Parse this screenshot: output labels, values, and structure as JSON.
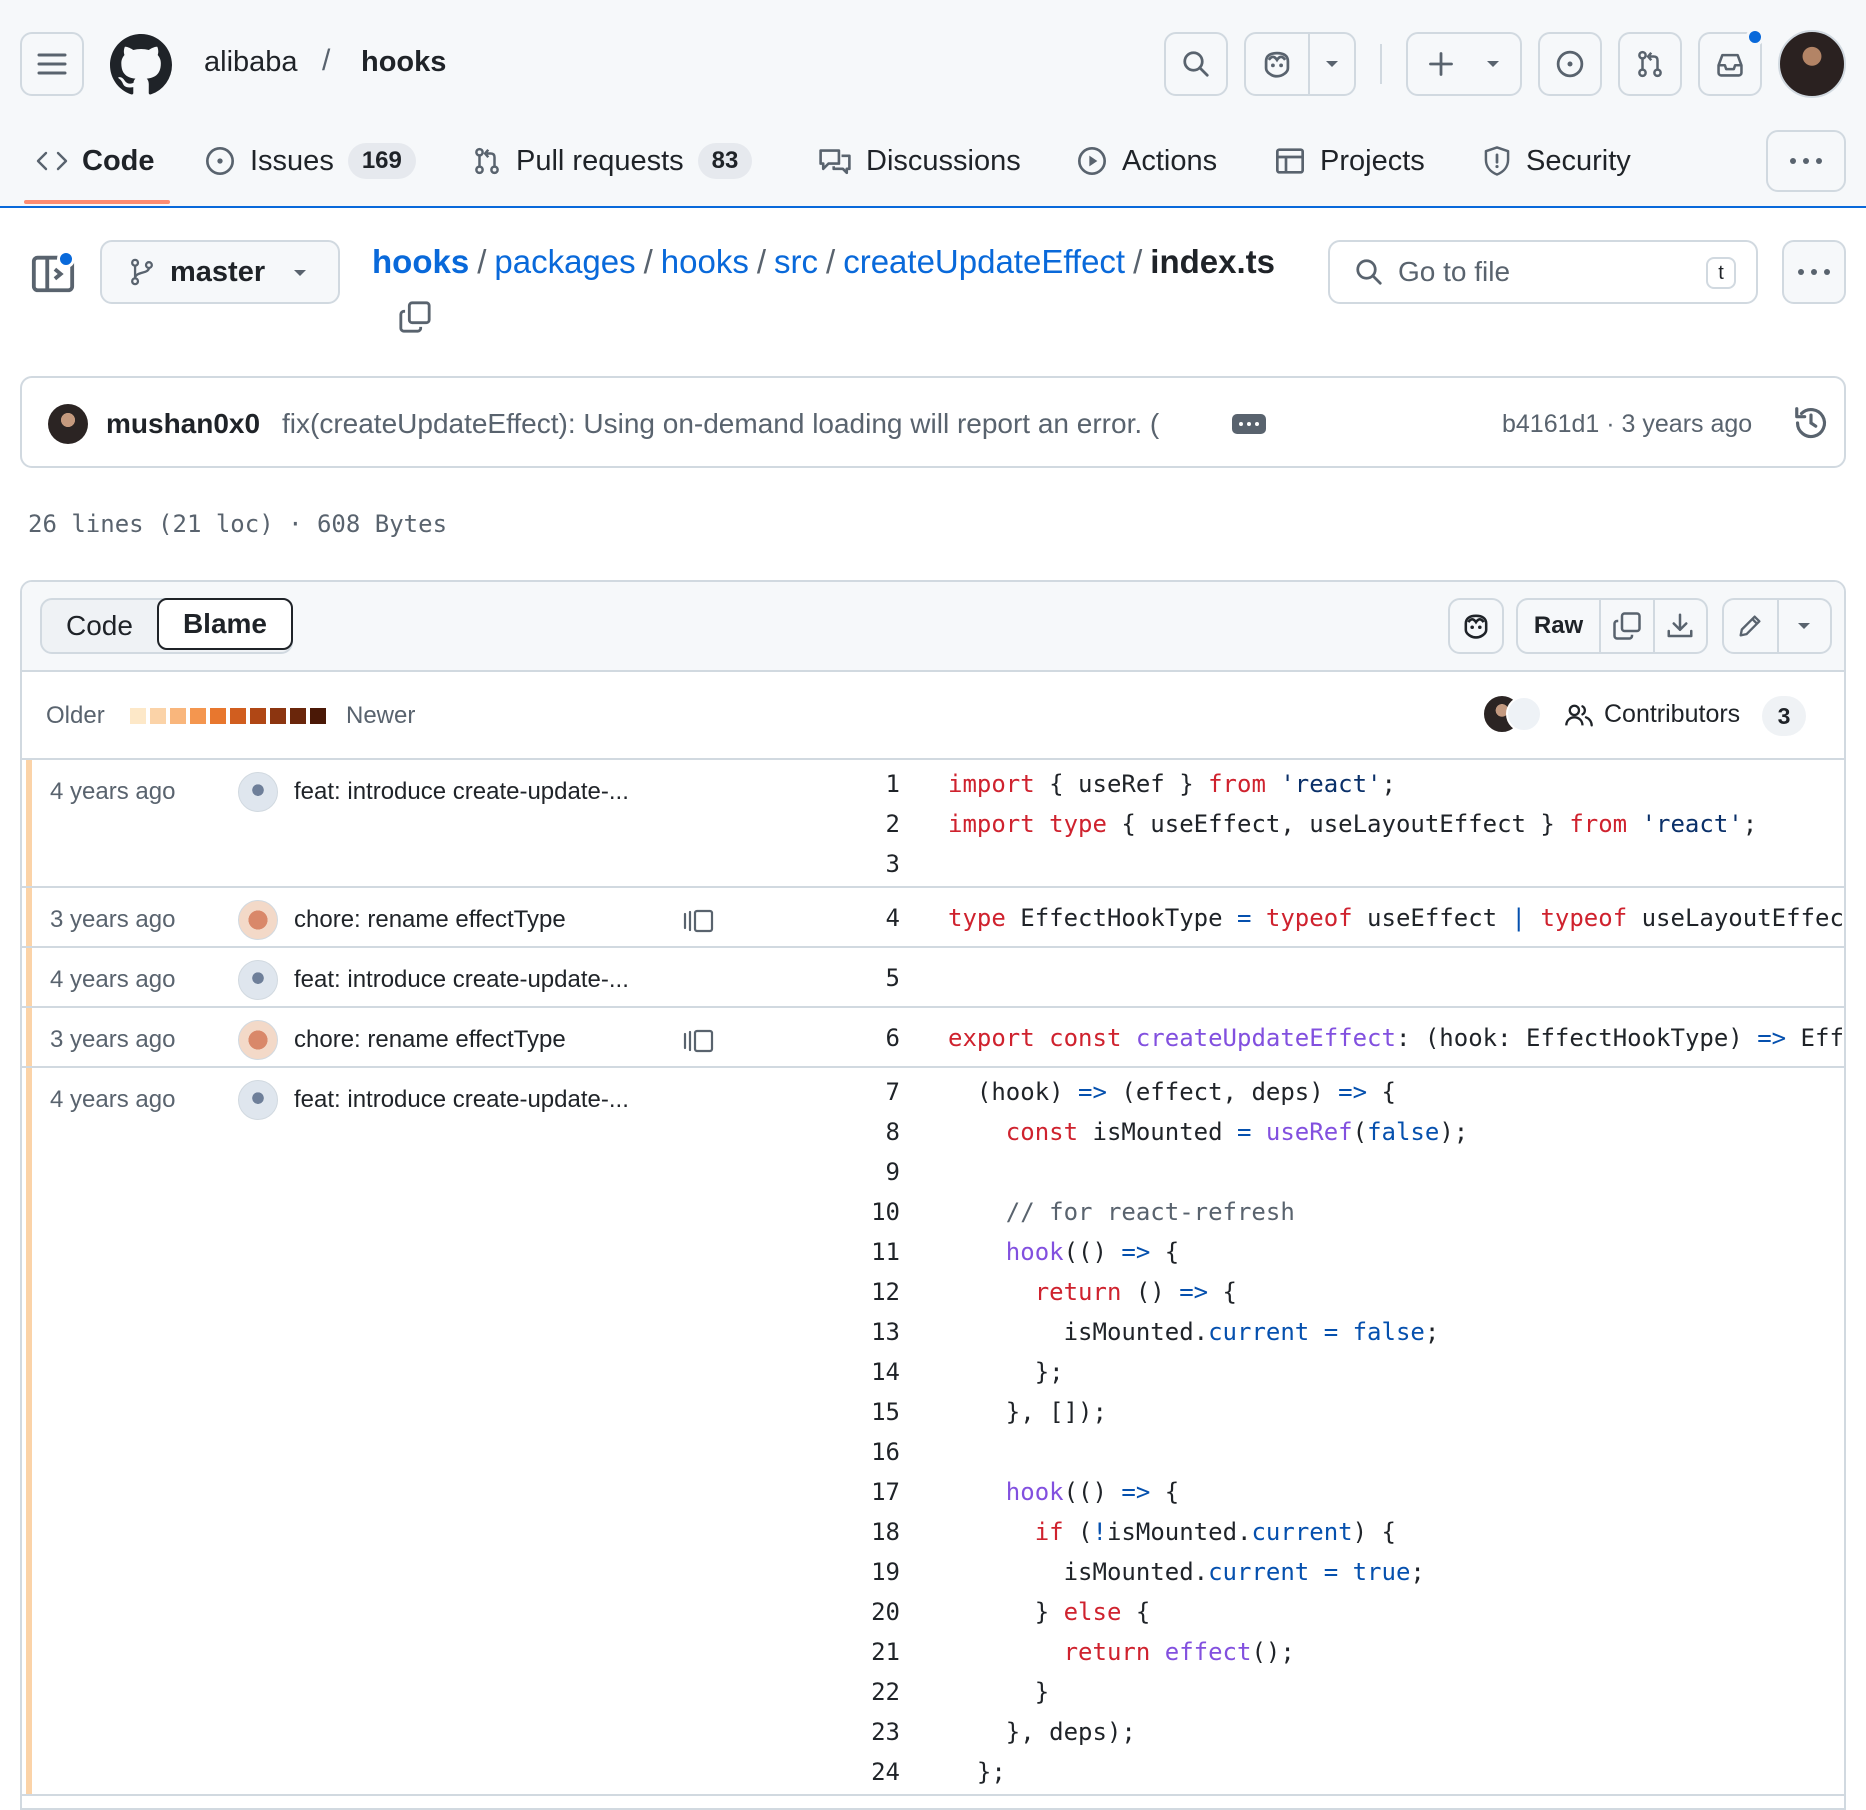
{
  "header": {
    "owner": "alibaba",
    "separator": "/",
    "repo": "hooks"
  },
  "repo_nav": {
    "code": "Code",
    "issues": "Issues",
    "issues_count": "169",
    "pulls": "Pull requests",
    "pulls_count": "83",
    "discussions": "Discussions",
    "actions": "Actions",
    "projects": "Projects",
    "security": "Security"
  },
  "file_header": {
    "branch": "master",
    "path": [
      "hooks",
      "packages",
      "hooks",
      "src",
      "createUpdateEffect"
    ],
    "filename": "index.ts",
    "goto_placeholder": "Go to file",
    "goto_shortcut": "t"
  },
  "commit": {
    "author": "mushan0x0",
    "message": "fix(createUpdateEffect): Using on-demand loading will report an error. (",
    "sha": "b4161d1",
    "time": "3 years ago"
  },
  "file_stats": "26 lines (21 loc) · 608 Bytes",
  "viewer": {
    "tab_code": "Code",
    "tab_blame": "Blame",
    "raw": "Raw",
    "legend_older": "Older",
    "legend_newer": "Newer",
    "legend_colors": [
      "#fde8c8",
      "#fbd3a8",
      "#f9b67c",
      "#f4964f",
      "#e8772e",
      "#d15e1f",
      "#b04715",
      "#8c3510",
      "#6a260b",
      "#4a1806"
    ],
    "contributors_label": "Contributors",
    "contributors_count": "3"
  },
  "blame": [
    {
      "age": "4 years ago",
      "avatar": "robot",
      "message": "feat: introduce create-update-...",
      "reblame": false,
      "lines": [
        1,
        2,
        3
      ]
    },
    {
      "age": "3 years ago",
      "avatar": "face",
      "message": "chore: rename effectType",
      "reblame": true,
      "lines": [
        4
      ]
    },
    {
      "age": "4 years ago",
      "avatar": "robot",
      "message": "feat: introduce create-update-...",
      "reblame": false,
      "lines": [
        5
      ]
    },
    {
      "age": "3 years ago",
      "avatar": "face",
      "message": "chore: rename effectType",
      "reblame": true,
      "lines": [
        6
      ]
    },
    {
      "age": "4 years ago",
      "avatar": "robot",
      "message": "feat: introduce create-update-...",
      "reblame": false,
      "lines": [
        7,
        8,
        9,
        10,
        11,
        12,
        13,
        14,
        15,
        16,
        17,
        18,
        19,
        20,
        21,
        22,
        23,
        24
      ]
    }
  ],
  "code_lines": [
    [
      [
        "kw",
        "import"
      ],
      [
        "p",
        " { useRef } "
      ],
      [
        "kw",
        "from"
      ],
      [
        "p",
        " "
      ],
      [
        "str",
        "'react'"
      ],
      [
        "p",
        ";"
      ]
    ],
    [
      [
        "kw",
        "import"
      ],
      [
        "p",
        " "
      ],
      [
        "kw",
        "type"
      ],
      [
        "p",
        " { useEffect, useLayoutEffect } "
      ],
      [
        "kw",
        "from"
      ],
      [
        "p",
        " "
      ],
      [
        "str",
        "'react'"
      ],
      [
        "p",
        ";"
      ]
    ],
    [
      [
        "p",
        ""
      ]
    ],
    [
      [
        "kw",
        "type"
      ],
      [
        "p",
        " EffectHookType "
      ],
      [
        "cst",
        "="
      ],
      [
        "p",
        " "
      ],
      [
        "kw",
        "typeof"
      ],
      [
        "p",
        " useEffect "
      ],
      [
        "cst",
        "|"
      ],
      [
        "p",
        " "
      ],
      [
        "kw",
        "typeof"
      ],
      [
        "p",
        " useLayoutEffect;"
      ]
    ],
    [
      [
        "p",
        ""
      ]
    ],
    [
      [
        "kw",
        "export"
      ],
      [
        "p",
        " "
      ],
      [
        "kw",
        "const"
      ],
      [
        "p",
        " "
      ],
      [
        "fn",
        "createUpdateEffect"
      ],
      [
        "p",
        ": (hook: EffectHookType) "
      ],
      [
        "cst",
        "=>"
      ],
      [
        "p",
        " Effect"
      ]
    ],
    [
      [
        "p",
        "  (hook) "
      ],
      [
        "cst",
        "=>"
      ],
      [
        "p",
        " (effect, deps) "
      ],
      [
        "cst",
        "=>"
      ],
      [
        "p",
        " {"
      ]
    ],
    [
      [
        "p",
        "    "
      ],
      [
        "kw",
        "const"
      ],
      [
        "p",
        " isMounted "
      ],
      [
        "cst",
        "="
      ],
      [
        "p",
        " "
      ],
      [
        "fn",
        "useRef"
      ],
      [
        "p",
        "("
      ],
      [
        "cst",
        "false"
      ],
      [
        "p",
        ");"
      ]
    ],
    [
      [
        "p",
        ""
      ]
    ],
    [
      [
        "cmt",
        "    // for react-refresh"
      ]
    ],
    [
      [
        "p",
        "    "
      ],
      [
        "fn",
        "hook"
      ],
      [
        "p",
        "(() "
      ],
      [
        "cst",
        "=>"
      ],
      [
        "p",
        " {"
      ]
    ],
    [
      [
        "p",
        "      "
      ],
      [
        "kw",
        "return"
      ],
      [
        "p",
        " () "
      ],
      [
        "cst",
        "=>"
      ],
      [
        "p",
        " {"
      ]
    ],
    [
      [
        "p",
        "        isMounted."
      ],
      [
        "cst",
        "current"
      ],
      [
        "p",
        " "
      ],
      [
        "cst",
        "="
      ],
      [
        "p",
        " "
      ],
      [
        "cst",
        "false"
      ],
      [
        "p",
        ";"
      ]
    ],
    [
      [
        "p",
        "      };"
      ]
    ],
    [
      [
        "p",
        "    }, []);"
      ]
    ],
    [
      [
        "p",
        ""
      ]
    ],
    [
      [
        "p",
        "    "
      ],
      [
        "fn",
        "hook"
      ],
      [
        "p",
        "(() "
      ],
      [
        "cst",
        "=>"
      ],
      [
        "p",
        " {"
      ]
    ],
    [
      [
        "p",
        "      "
      ],
      [
        "kw",
        "if"
      ],
      [
        "p",
        " ("
      ],
      [
        "cst",
        "!"
      ],
      [
        "p",
        "isMounted."
      ],
      [
        "cst",
        "current"
      ],
      [
        "p",
        ") {"
      ]
    ],
    [
      [
        "p",
        "        isMounted."
      ],
      [
        "cst",
        "current"
      ],
      [
        "p",
        " "
      ],
      [
        "cst",
        "="
      ],
      [
        "p",
        " "
      ],
      [
        "cst",
        "true"
      ],
      [
        "p",
        ";"
      ]
    ],
    [
      [
        "p",
        "      } "
      ],
      [
        "kw",
        "else"
      ],
      [
        "p",
        " {"
      ]
    ],
    [
      [
        "p",
        "        "
      ],
      [
        "kw",
        "return"
      ],
      [
        "p",
        " "
      ],
      [
        "fn",
        "effect"
      ],
      [
        "p",
        "();"
      ]
    ],
    [
      [
        "p",
        "      }"
      ]
    ],
    [
      [
        "p",
        "    }, deps);"
      ]
    ],
    [
      [
        "p",
        "  };"
      ]
    ]
  ]
}
